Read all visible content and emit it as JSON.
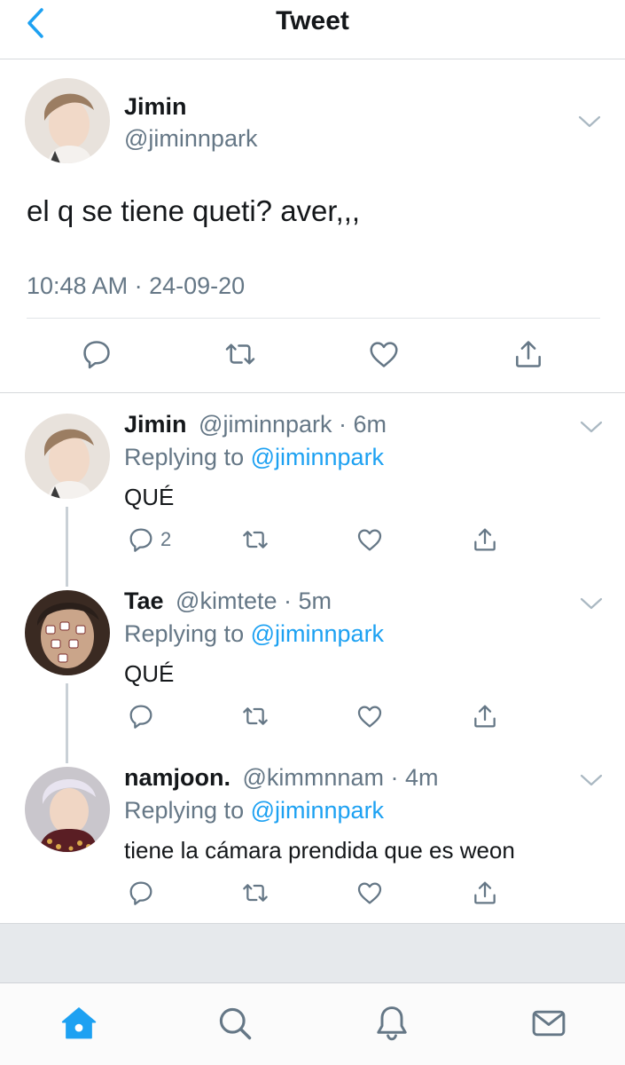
{
  "header": {
    "title": "Tweet",
    "back_icon": "chevron-left-icon"
  },
  "main_tweet": {
    "name": "Jimin",
    "handle": "@jiminnpark",
    "text": "el q se tiene queti? aver,,,",
    "timestamp": "10:48 AM · 24-09-20"
  },
  "replies": [
    {
      "name": "Jimin",
      "handle": "@jiminnpark",
      "dot": "·",
      "time": "6m",
      "replying_label": "Replying to",
      "replying_to": "@jiminnpark",
      "text": "QUÉ",
      "reply_count": "2"
    },
    {
      "name": "Tae",
      "handle": "@kimtete",
      "dot": "·",
      "time": "5m",
      "replying_label": "Replying to",
      "replying_to": "@jiminnpark",
      "text": "QUÉ",
      "reply_count": ""
    },
    {
      "name": "namjoon.",
      "handle": "@kimmnnam",
      "dot": "·",
      "time": "4m",
      "replying_label": "Replying to",
      "replying_to": "@jiminnpark",
      "text": "tiene la cámara prendida que es weon",
      "reply_count": ""
    }
  ],
  "tabs": [
    {
      "name": "home-icon",
      "active": true
    },
    {
      "name": "search-icon",
      "active": false
    },
    {
      "name": "bell-icon",
      "active": false
    },
    {
      "name": "mail-icon",
      "active": false
    }
  ],
  "colors": {
    "accent": "#1da1f2",
    "muted": "#657786",
    "text": "#14171a",
    "icon": "#657786"
  }
}
